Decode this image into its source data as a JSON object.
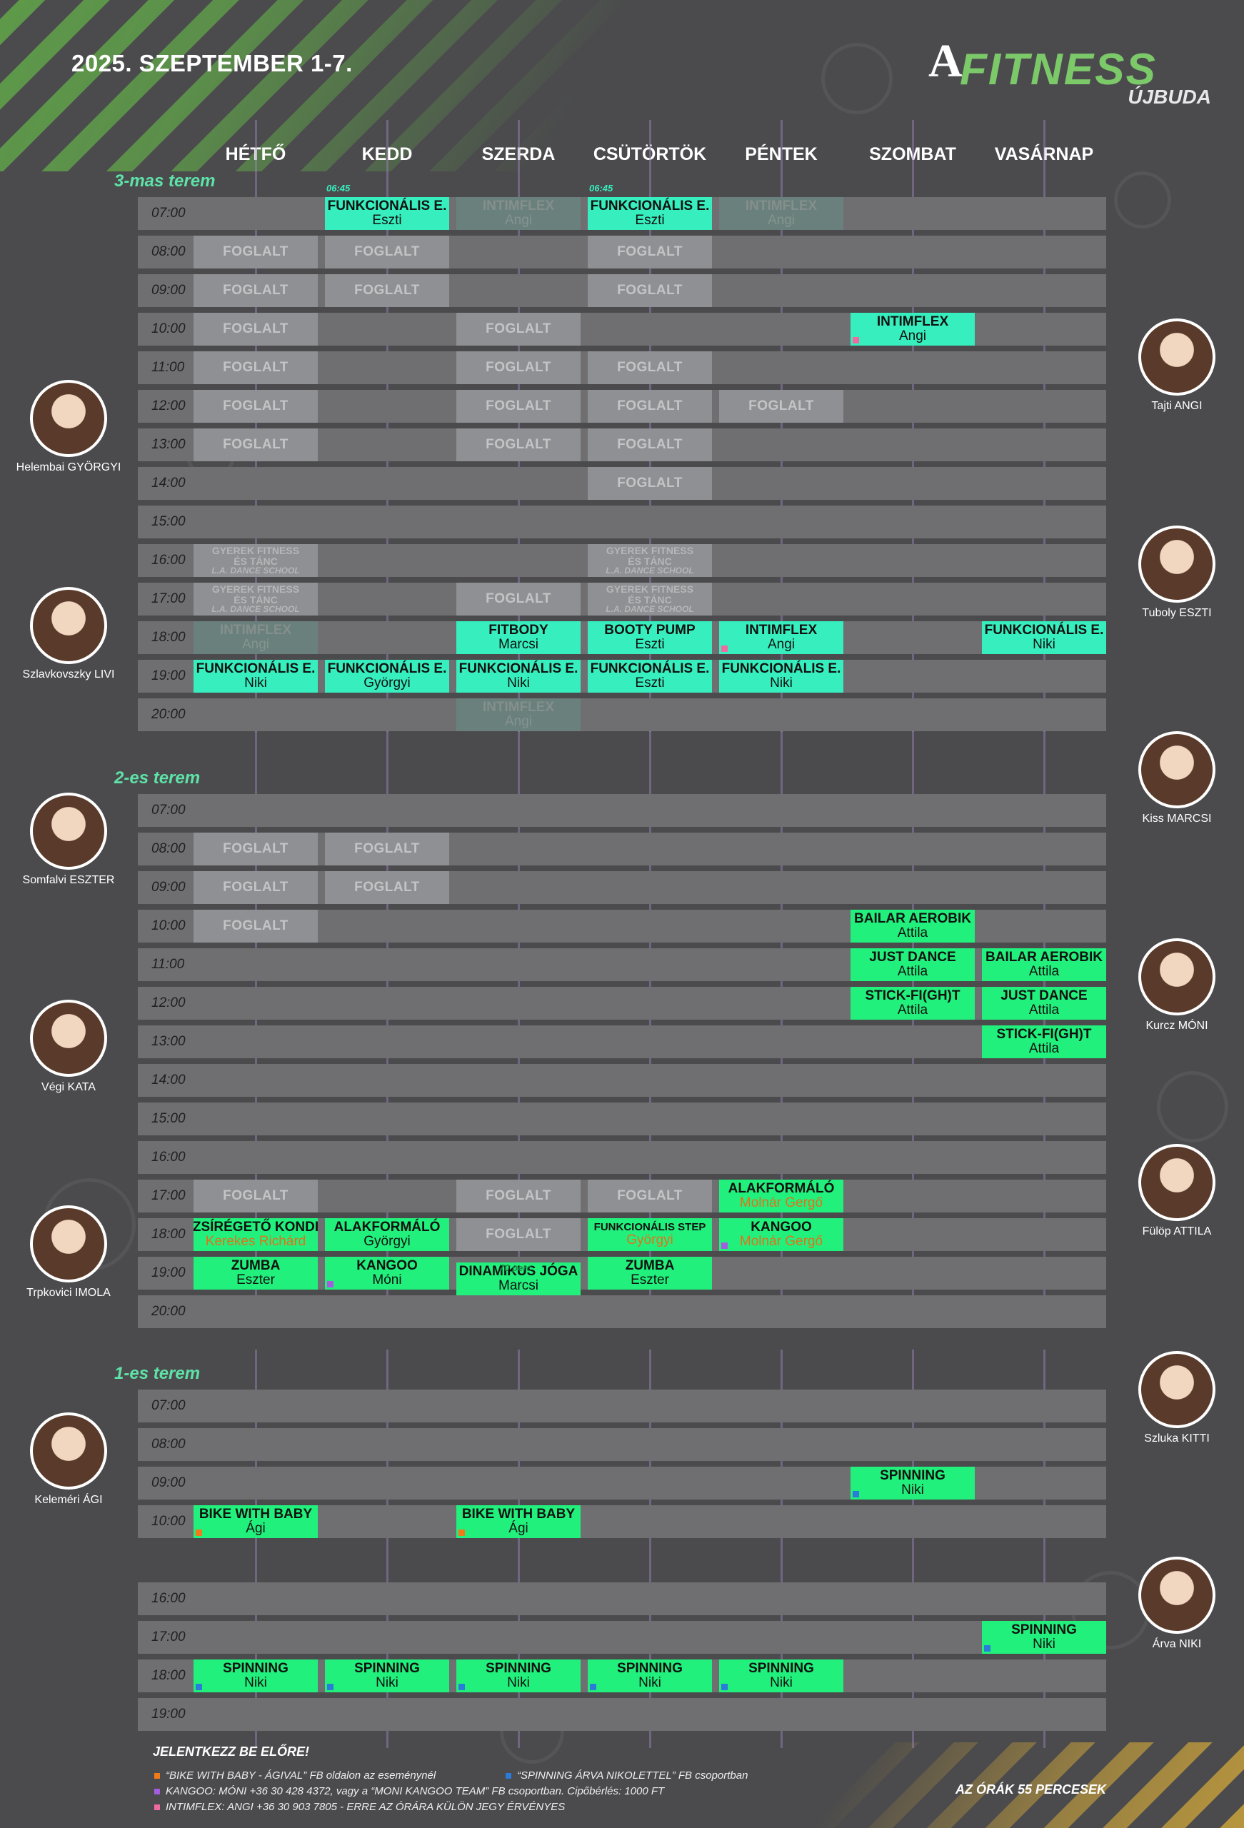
{
  "header": {
    "title": "2025. SZEPTEMBER 1-7.",
    "logo_a": "A",
    "logo_text": "FITNESS",
    "logo_location": "ÚJBUDA"
  },
  "colors": {
    "class_teal": "#37efbe",
    "class_green": "#22f07c",
    "busy_gray": "#8f9093",
    "row_gray": "#6f6f72",
    "room_label": "#5ee2a8",
    "orange": "#e0731b",
    "square_orange": "#f07b1a",
    "square_blue": "#2b7bd8",
    "square_purple": "#a55de0",
    "square_pink": "#f06aa0"
  },
  "days": [
    "HÉTFŐ",
    "KEDD",
    "SZERDA",
    "CSÜTÖRTÖK",
    "PÉNTEK",
    "SZOMBAT",
    "VASÁRNAP"
  ],
  "rooms": [
    {
      "name": "3-mas terem",
      "rows": [
        "07:00",
        "08:00",
        "09:00",
        "10:00",
        "11:00",
        "12:00",
        "13:00",
        "14:00",
        "15:00",
        "16:00",
        "17:00",
        "18:00",
        "19:00",
        "20:00"
      ],
      "cells": [
        {
          "day": 1,
          "row": 0,
          "type": "cls",
          "l1": "FUNKCIONÁLIS E.",
          "l2": "Eszti",
          "pre": "06:45"
        },
        {
          "day": 2,
          "row": 0,
          "type": "ghost",
          "l1": "INTIMFLEX",
          "l2": "Angi"
        },
        {
          "day": 3,
          "row": 0,
          "type": "cls",
          "l1": "FUNKCIONÁLIS E.",
          "l2": "Eszti",
          "pre": "06:45"
        },
        {
          "day": 4,
          "row": 0,
          "type": "ghost",
          "l1": "INTIMFLEX",
          "l2": "Angi"
        },
        {
          "day": 0,
          "row": 1,
          "type": "busy",
          "l1": "FOGLALT"
        },
        {
          "day": 1,
          "row": 1,
          "type": "busy",
          "l1": "FOGLALT"
        },
        {
          "day": 3,
          "row": 1,
          "type": "busy",
          "l1": "FOGLALT"
        },
        {
          "day": 0,
          "row": 2,
          "type": "busy",
          "l1": "FOGLALT"
        },
        {
          "day": 1,
          "row": 2,
          "type": "busy",
          "l1": "FOGLALT"
        },
        {
          "day": 3,
          "row": 2,
          "type": "busy",
          "l1": "FOGLALT"
        },
        {
          "day": 0,
          "row": 3,
          "type": "busy",
          "l1": "FOGLALT"
        },
        {
          "day": 2,
          "row": 3,
          "type": "busy",
          "l1": "FOGLALT"
        },
        {
          "day": 5,
          "row": 3,
          "type": "cls",
          "l1": "INTIMFLEX",
          "l2": "Angi",
          "sq": "pink"
        },
        {
          "day": 0,
          "row": 4,
          "type": "busy",
          "l1": "FOGLALT"
        },
        {
          "day": 2,
          "row": 4,
          "type": "busy",
          "l1": "FOGLALT"
        },
        {
          "day": 3,
          "row": 4,
          "type": "busy",
          "l1": "FOGLALT"
        },
        {
          "day": 0,
          "row": 5,
          "type": "busy",
          "l1": "FOGLALT"
        },
        {
          "day": 2,
          "row": 5,
          "type": "busy",
          "l1": "FOGLALT"
        },
        {
          "day": 3,
          "row": 5,
          "type": "busy",
          "l1": "FOGLALT"
        },
        {
          "day": 4,
          "row": 5,
          "type": "busy",
          "l1": "FOGLALT"
        },
        {
          "day": 0,
          "row": 6,
          "type": "busy",
          "l1": "FOGLALT"
        },
        {
          "day": 2,
          "row": 6,
          "type": "busy",
          "l1": "FOGLALT"
        },
        {
          "day": 3,
          "row": 6,
          "type": "busy",
          "l1": "FOGLALT"
        },
        {
          "day": 3,
          "row": 7,
          "type": "busy",
          "l1": "FOGLALT"
        },
        {
          "day": 0,
          "row": 9,
          "type": "school",
          "l1": "GYEREK FITNESS",
          "l2": "ÉS TÁNC",
          "l3": "L.A. DANCE SCHOOL"
        },
        {
          "day": 3,
          "row": 9,
          "type": "school",
          "l1": "GYEREK FITNESS",
          "l2": "ÉS TÁNC",
          "l3": "L.A. DANCE SCHOOL"
        },
        {
          "day": 0,
          "row": 10,
          "type": "school",
          "l1": "GYEREK FITNESS",
          "l2": "ÉS TÁNC",
          "l3": "L.A. DANCE SCHOOL"
        },
        {
          "day": 2,
          "row": 10,
          "type": "busy",
          "l1": "FOGLALT"
        },
        {
          "day": 3,
          "row": 10,
          "type": "school",
          "l1": "GYEREK FITNESS",
          "l2": "ÉS TÁNC",
          "l3": "L.A. DANCE SCHOOL"
        },
        {
          "day": 0,
          "row": 11,
          "type": "ghost",
          "l1": "INTIMFLEX",
          "l2": "Angi"
        },
        {
          "day": 2,
          "row": 11,
          "type": "cls",
          "l1": "FITBODY",
          "l2": "Marcsi"
        },
        {
          "day": 3,
          "row": 11,
          "type": "cls",
          "l1": "BOOTY PUMP",
          "l2": "Eszti"
        },
        {
          "day": 4,
          "row": 11,
          "type": "cls",
          "l1": "INTIMFLEX",
          "l2": "Angi",
          "sq": "pink"
        },
        {
          "day": 6,
          "row": 11,
          "type": "cls",
          "l1": "FUNKCIONÁLIS E.",
          "l2": "Niki"
        },
        {
          "day": 0,
          "row": 12,
          "type": "cls",
          "l1": "FUNKCIONÁLIS E.",
          "l2": "Niki"
        },
        {
          "day": 1,
          "row": 12,
          "type": "cls",
          "l1": "FUNKCIONÁLIS E.",
          "l2": "Györgyi"
        },
        {
          "day": 2,
          "row": 12,
          "type": "cls",
          "l1": "FUNKCIONÁLIS E.",
          "l2": "Niki"
        },
        {
          "day": 3,
          "row": 12,
          "type": "cls",
          "l1": "FUNKCIONÁLIS E.",
          "l2": "Eszti"
        },
        {
          "day": 4,
          "row": 12,
          "type": "cls",
          "l1": "FUNKCIONÁLIS E.",
          "l2": "Niki"
        },
        {
          "day": 2,
          "row": 13,
          "type": "ghost",
          "l1": "INTIMFLEX",
          "l2": "Angi"
        }
      ]
    },
    {
      "name": "2-es terem",
      "rows": [
        "07:00",
        "08:00",
        "09:00",
        "10:00",
        "11:00",
        "12:00",
        "13:00",
        "14:00",
        "15:00",
        "16:00",
        "17:00",
        "18:00",
        "19:00",
        "20:00"
      ],
      "cells": [
        {
          "day": 0,
          "row": 1,
          "type": "busy",
          "l1": "FOGLALT"
        },
        {
          "day": 1,
          "row": 1,
          "type": "busy",
          "l1": "FOGLALT"
        },
        {
          "day": 0,
          "row": 2,
          "type": "busy",
          "l1": "FOGLALT"
        },
        {
          "day": 1,
          "row": 2,
          "type": "busy",
          "l1": "FOGLALT"
        },
        {
          "day": 0,
          "row": 3,
          "type": "busy",
          "l1": "FOGLALT"
        },
        {
          "day": 5,
          "row": 3,
          "type": "grn",
          "l1": "BAILAR AEROBIK",
          "l2": "Attila"
        },
        {
          "day": 5,
          "row": 4,
          "type": "grn",
          "l1": "JUST DANCE",
          "l2": "Attila"
        },
        {
          "day": 6,
          "row": 4,
          "type": "grn",
          "l1": "BAILAR AEROBIK",
          "l2": "Attila"
        },
        {
          "day": 5,
          "row": 5,
          "type": "grn",
          "l1": "STICK-FI(GH)T",
          "l2": "Attila"
        },
        {
          "day": 6,
          "row": 5,
          "type": "grn",
          "l1": "JUST DANCE",
          "l2": "Attila"
        },
        {
          "day": 6,
          "row": 6,
          "type": "grn",
          "l1": "STICK-FI(GH)T",
          "l2": "Attila"
        },
        {
          "day": 0,
          "row": 10,
          "type": "busy",
          "l1": "FOGLALT"
        },
        {
          "day": 2,
          "row": 10,
          "type": "busy",
          "l1": "FOGLALT"
        },
        {
          "day": 3,
          "row": 10,
          "type": "busy",
          "l1": "FOGLALT"
        },
        {
          "day": 4,
          "row": 10,
          "type": "grn",
          "l1": "ALAKFORMÁLÓ",
          "l2": "Molnár Gergő",
          "orange": true
        },
        {
          "day": 0,
          "row": 11,
          "type": "grn",
          "l1": "ZSÍRÉGETŐ KONDI",
          "l2": "Kerekes Richárd",
          "orange": true
        },
        {
          "day": 1,
          "row": 11,
          "type": "grn",
          "l1": "ALAKFORMÁLÓ",
          "l2": "Györgyi"
        },
        {
          "day": 2,
          "row": 11,
          "type": "busy",
          "l1": "FOGLALT"
        },
        {
          "day": 3,
          "row": 11,
          "type": "grn",
          "l1": "FUNKCIONÁLIS STEP",
          "l2": "Györgyi",
          "orange": true,
          "small": true
        },
        {
          "day": 4,
          "row": 11,
          "type": "grn",
          "l1": "KANGOO",
          "l2": "Molnár Gergő",
          "orange": true,
          "sq": "purple"
        },
        {
          "day": 0,
          "row": 12,
          "type": "grn",
          "l1": "ZUMBA",
          "l2": "Eszter"
        },
        {
          "day": 1,
          "row": 12,
          "type": "grn",
          "l1": "KANGOO",
          "l2": "Móni",
          "sq": "purple"
        },
        {
          "day": 2,
          "row": 12,
          "type": "grn",
          "l1": "DINAMIKUS JÓGA",
          "l2": "Marcsi",
          "pre": "70 perc",
          "tall": true
        },
        {
          "day": 3,
          "row": 12,
          "type": "grn",
          "l1": "ZUMBA",
          "l2": "Eszter"
        }
      ]
    },
    {
      "name": "1-es terem",
      "rows": [
        "07:00",
        "08:00",
        "09:00",
        "10:00",
        "",
        "16:00",
        "17:00",
        "18:00",
        "19:00"
      ],
      "cells": [
        {
          "day": 5,
          "row": 2,
          "type": "grn",
          "l1": "SPINNING",
          "l2": "Niki",
          "sq": "blue"
        },
        {
          "day": 0,
          "row": 3,
          "type": "grn",
          "l1": "BIKE WITH BABY",
          "l2": "Ági",
          "sq": "orange"
        },
        {
          "day": 2,
          "row": 3,
          "type": "grn",
          "l1": "BIKE WITH BABY",
          "l2": "Ági",
          "sq": "orange"
        },
        {
          "day": 6,
          "row": 6,
          "type": "grn",
          "l1": "SPINNING",
          "l2": "Niki",
          "sq": "blue"
        },
        {
          "day": 0,
          "row": 7,
          "type": "grn",
          "l1": "SPINNING",
          "l2": "Niki",
          "sq": "blue"
        },
        {
          "day": 1,
          "row": 7,
          "type": "grn",
          "l1": "SPINNING",
          "l2": "Niki",
          "sq": "blue"
        },
        {
          "day": 2,
          "row": 7,
          "type": "grn",
          "l1": "SPINNING",
          "l2": "Niki",
          "sq": "blue"
        },
        {
          "day": 3,
          "row": 7,
          "type": "grn",
          "l1": "SPINNING",
          "l2": "Niki",
          "sq": "blue"
        },
        {
          "day": 4,
          "row": 7,
          "type": "grn",
          "l1": "SPINNING",
          "l2": "Niki",
          "sq": "blue"
        }
      ]
    }
  ],
  "trainers_left": [
    {
      "name": "Helembai GYÖRGYI"
    },
    {
      "name": "Szlavkovszky LIVI"
    },
    {
      "name": "Somfalvi ESZTER"
    },
    {
      "name": "Végi KATA"
    },
    {
      "name": "Trpkovici IMOLA"
    },
    {
      "name": "Keleméri ÁGI"
    }
  ],
  "trainers_right": [
    {
      "name": "Tajti ANGI"
    },
    {
      "name": "Tuboly ESZTI"
    },
    {
      "name": "Kiss MARCSI"
    },
    {
      "name": "Kurcz MÓNI"
    },
    {
      "name": "Fülöp ATTILA"
    },
    {
      "name": "Szluka KITTI"
    },
    {
      "name": "Árva NIKI"
    }
  ],
  "footer": {
    "heading": "JELENTKEZZ BE ELŐRE!",
    "note_baby": "“BIKE WITH BABY - ÁGIVAL” FB oldalon az eseménynél",
    "note_spinning": "“SPINNING ÁRVA NIKOLETTEL” FB csoportban",
    "note_kangoo": "KANGOO: MÓNI +36 30 428 4372, vagy a “MONI KANGOO TEAM” FB csoportban. Cipőbérlés: 1000 FT",
    "note_intimflex": "INTIMFLEX: ANGI +36 30 903 7805 - ERRE AZ ÓRÁRA KÜLÖN JEGY ÉRVÉNYES",
    "duration": "AZ ÓRÁK 55 PERCESEK"
  }
}
